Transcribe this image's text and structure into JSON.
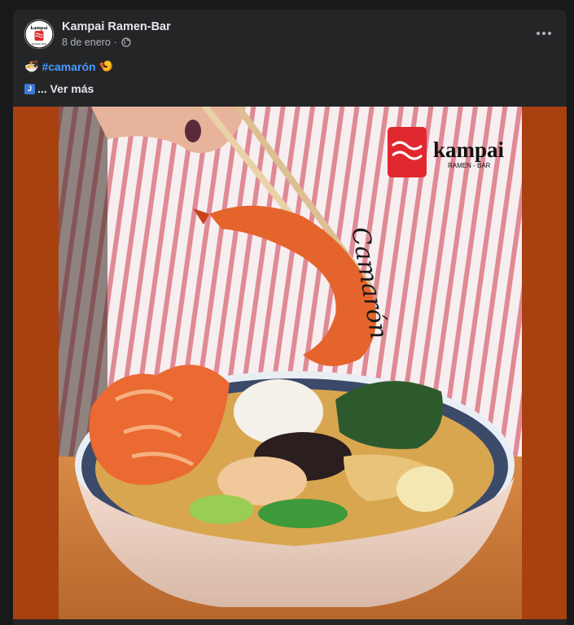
{
  "post": {
    "author": "Kampai Ramen-Bar",
    "date": "8 de enero",
    "separator": "·",
    "privacy_icon": "globe-icon",
    "more_icon": "more-options-icon",
    "caption": {
      "leading_emoji": "🍜",
      "hashtag": "#camarón",
      "trailing_emoji": "🍤",
      "badge": "J",
      "see_more": "... Ver más"
    }
  },
  "logo": {
    "brand_name": "kampai",
    "brand_sub": "RAMEN - BAR",
    "overlay_text": "Camarón"
  },
  "colors": {
    "background": "#18191a",
    "card": "#242526",
    "link": "#4599ff",
    "media_frame": "#a84010",
    "brand_red": "#e0282e"
  }
}
